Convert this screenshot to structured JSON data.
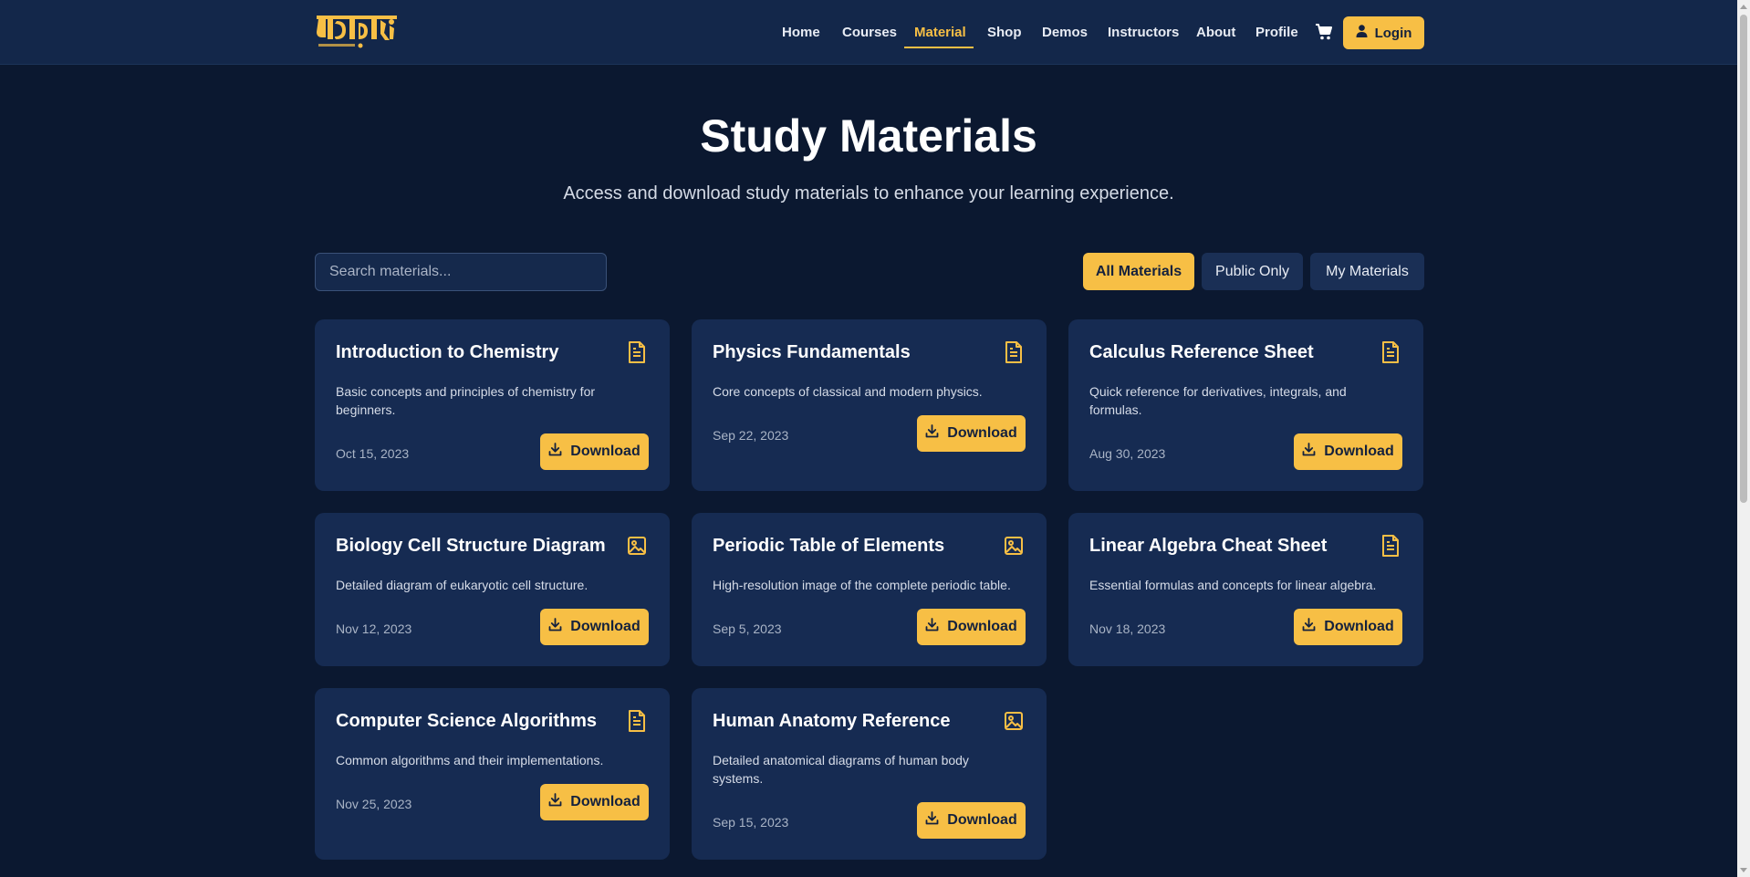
{
  "nav": {
    "links": [
      {
        "label": "Home"
      },
      {
        "label": "Courses"
      },
      {
        "label": "Material"
      },
      {
        "label": "Shop"
      },
      {
        "label": "Demos"
      },
      {
        "label": "Instructors"
      },
      {
        "label": "About"
      },
      {
        "label": "Profile"
      }
    ],
    "active": "Material",
    "login_label": "Login",
    "logo_text": "বিদ্যার্থী"
  },
  "hero": {
    "title": "Study Materials",
    "subtitle": "Access and download study materials to enhance your learning experience."
  },
  "search": {
    "placeholder": "Search materials...",
    "value": ""
  },
  "filters": [
    {
      "label": "All Materials",
      "active": true
    },
    {
      "label": "Public Only",
      "active": false
    },
    {
      "label": "My Materials",
      "active": false
    }
  ],
  "materials": [
    {
      "title": "Introduction to Chemistry",
      "description": "Basic concepts and principles of chemistry for beginners.",
      "date": "Oct 15, 2023",
      "icon": "document-icon",
      "download_label": "Download"
    },
    {
      "title": "Physics Fundamentals",
      "description": "Core concepts of classical and modern physics.",
      "date": "Sep 22, 2023",
      "icon": "document-icon",
      "download_label": "Download"
    },
    {
      "title": "Calculus Reference Sheet",
      "description": "Quick reference for derivatives, integrals, and formulas.",
      "date": "Aug 30, 2023",
      "icon": "document-icon",
      "download_label": "Download"
    },
    {
      "title": "Biology Cell Structure Diagram",
      "description": "Detailed diagram of eukaryotic cell structure.",
      "date": "Nov 12, 2023",
      "icon": "image-icon",
      "download_label": "Download"
    },
    {
      "title": "Periodic Table of Elements",
      "description": "High-resolution image of the complete periodic table.",
      "date": "Sep 5, 2023",
      "icon": "image-icon",
      "download_label": "Download"
    },
    {
      "title": "Linear Algebra Cheat Sheet",
      "description": "Essential formulas and concepts for linear algebra.",
      "date": "Nov 18, 2023",
      "icon": "document-icon",
      "download_label": "Download"
    },
    {
      "title": "Computer Science Algorithms",
      "description": "Common algorithms and their implementations.",
      "date": "Nov 25, 2023",
      "icon": "document-icon",
      "download_label": "Download"
    },
    {
      "title": "Human Anatomy Reference",
      "description": "Detailed anatomical diagrams of human body systems.",
      "date": "Sep 15, 2023",
      "icon": "image-icon",
      "download_label": "Download"
    }
  ],
  "colors": {
    "background": "#0b1830",
    "navbar": "#13274a",
    "card": "#162b52",
    "accent": "#f7bf45",
    "text_dark": "#14213d"
  }
}
